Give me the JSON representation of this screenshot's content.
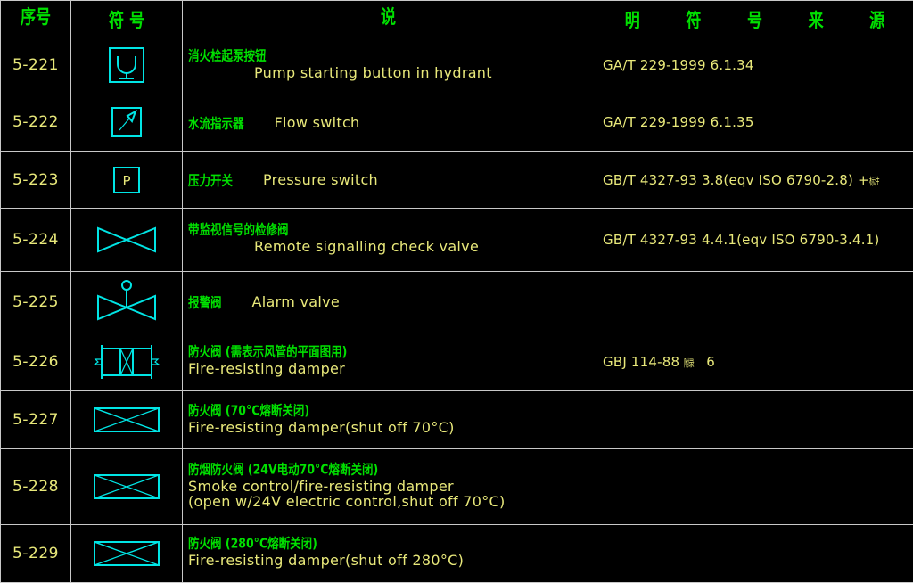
{
  "table": {
    "headers": [
      {
        "name": "col-no",
        "label": "序号"
      },
      {
        "name": "col-symbol",
        "label": "符  号"
      },
      {
        "name": "col-desc",
        "label": "说"
      },
      {
        "name": "col-source",
        "label_parts": [
          "明",
          "符",
          "号",
          "来",
          "源"
        ]
      }
    ],
    "colors": {
      "background": "#000000",
      "grid": "#c8c8c8",
      "chinese_text": "#00e000",
      "english_text": "#e8e87a",
      "symbol": "#00e5e5"
    },
    "rows": [
      {
        "no": "5-221",
        "symbol_name": "pump-starting-button-in-hydrant-symbol",
        "cn": "消火栓起泵按钮",
        "en": "Pump starting button in hydrant",
        "layout": "stacked",
        "source": "GA/T 229-1999 6.1.34",
        "source_cjk": ""
      },
      {
        "no": "5-222",
        "symbol_name": "flow-switch-symbol",
        "cn": "水流指示器",
        "en": "Flow switch",
        "layout": "inline",
        "source": "GA/T 229-1999 6.1.35",
        "source_cjk": ""
      },
      {
        "no": "5-223",
        "symbol_name": "pressure-switch-symbol",
        "cn": "压力开关",
        "en": "Pressure switch",
        "layout": "inline",
        "source": "GB/T 4327-93 3.8(eqv ISO 6790-2.8) +",
        "source_cjk": "标注"
      },
      {
        "no": "5-224",
        "symbol_name": "remote-signalling-check-valve-symbol",
        "cn": "带监视信号的检修阀",
        "en": "Remote signalling check valve",
        "layout": "stacked-indent",
        "source": "GB/T 4327-93 4.4.1(eqv ISO 6790-3.4.1)",
        "source_cjk": ""
      },
      {
        "no": "5-225",
        "symbol_name": "alarm-valve-symbol",
        "cn": "报警阀",
        "en": "Alarm valve",
        "layout": "inline",
        "source": "",
        "source_cjk": ""
      },
      {
        "no": "5-226",
        "symbol_name": "fire-resisting-damper-plan-symbol",
        "cn": "防火阀 (需表示风管的平面图用)",
        "en": "Fire-resisting damper",
        "layout": "stacked",
        "source": "GBJ 114-88",
        "source_cjk": "附录",
        "source_tail": "6"
      },
      {
        "no": "5-227",
        "symbol_name": "fire-resisting-damper-70c-symbol",
        "cn": "防火阀 (70°C熔断关闭)",
        "en": "Fire-resisting damper(shut off 70°C)",
        "layout": "stacked",
        "source": "",
        "source_cjk": ""
      },
      {
        "no": "5-228",
        "symbol_name": "smoke-control-fire-resisting-damper-symbol",
        "cn": "防烟防火阀 (24V电动70°C熔断关闭)",
        "en": "Smoke control/fire-resisting damper",
        "en2": "(open w/24V electric control,shut off 70°C)",
        "layout": "stacked3",
        "source": "",
        "source_cjk": ""
      },
      {
        "no": "5-229",
        "symbol_name": "fire-resisting-damper-280c-symbol",
        "cn": "防火阀 (280°C熔断关闭)",
        "en": "Fire-resisting damper(shut off 280°C)",
        "layout": "stacked",
        "source": "",
        "source_cjk": ""
      }
    ]
  }
}
